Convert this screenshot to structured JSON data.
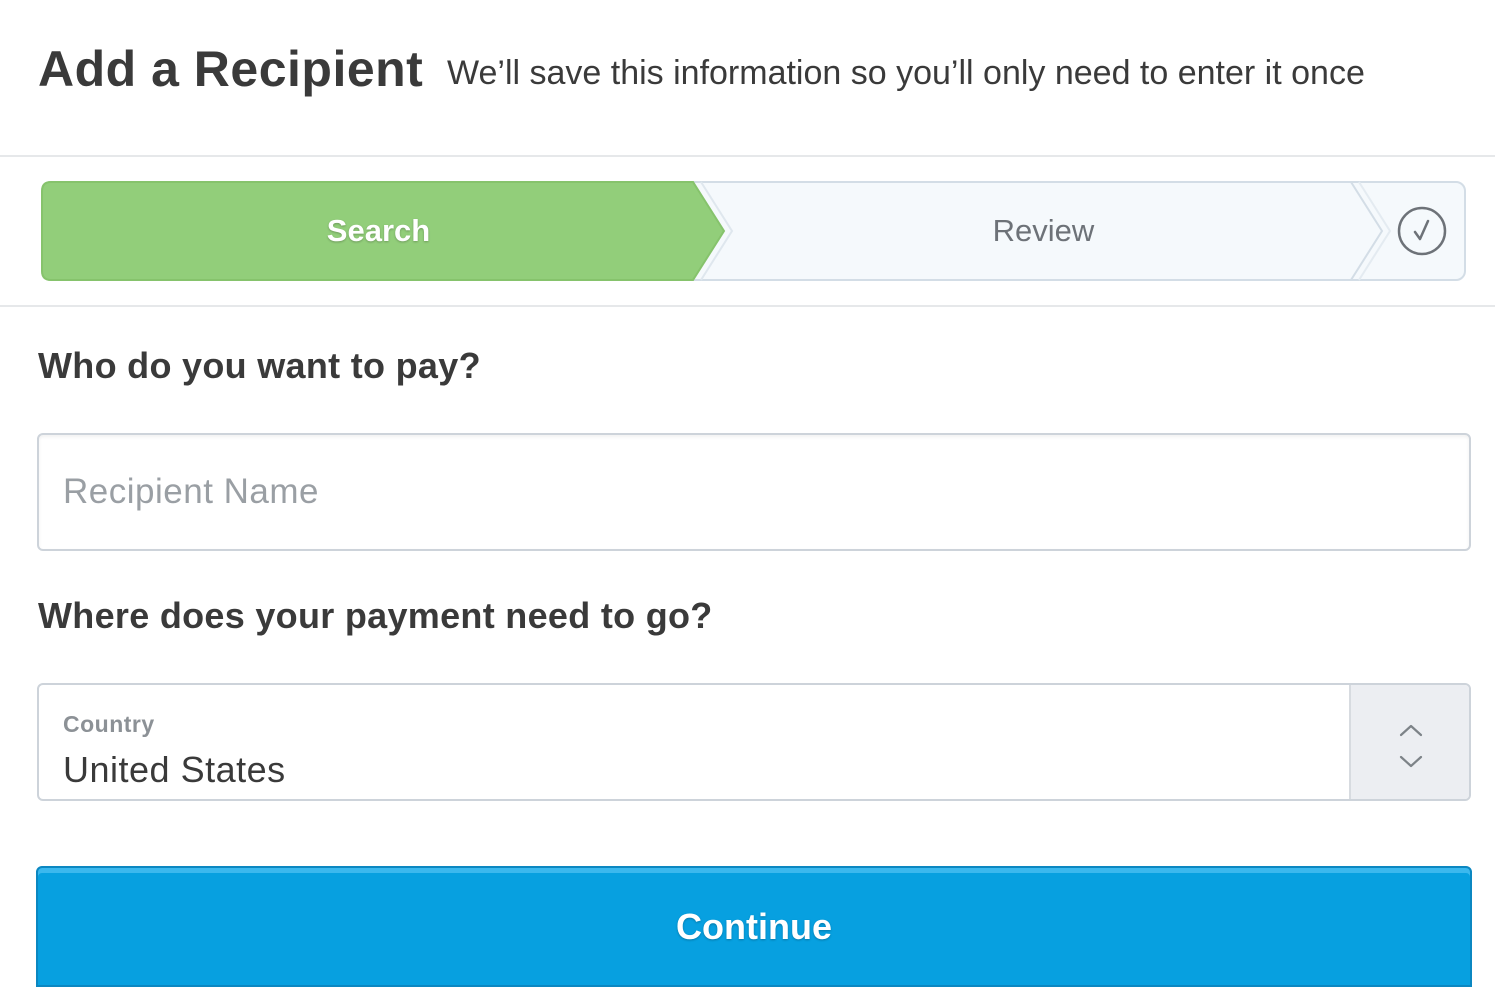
{
  "header": {
    "title": "Add a Recipient",
    "subtitle": "We’ll save this information so you’ll only need to enter it once"
  },
  "stepper": {
    "steps": [
      {
        "label": "Search",
        "state": "active"
      },
      {
        "label": "Review",
        "state": "upcoming"
      },
      {
        "label": "",
        "state": "upcoming",
        "icon": "check-circle-icon"
      }
    ],
    "colors": {
      "active": "#92ce7a",
      "upcoming": "#f5f9fc"
    }
  },
  "form": {
    "recipient": {
      "question": "Who do you want to pay?",
      "placeholder": "Recipient Name",
      "value": ""
    },
    "destination": {
      "question": "Where does your payment need to go?",
      "country_label": "Country",
      "country_value": "United States",
      "arrow_icons": [
        "chevron-up-icon",
        "chevron-down-icon"
      ]
    }
  },
  "actions": {
    "continue_label": "Continue",
    "continue_color": "#07a0e0"
  }
}
